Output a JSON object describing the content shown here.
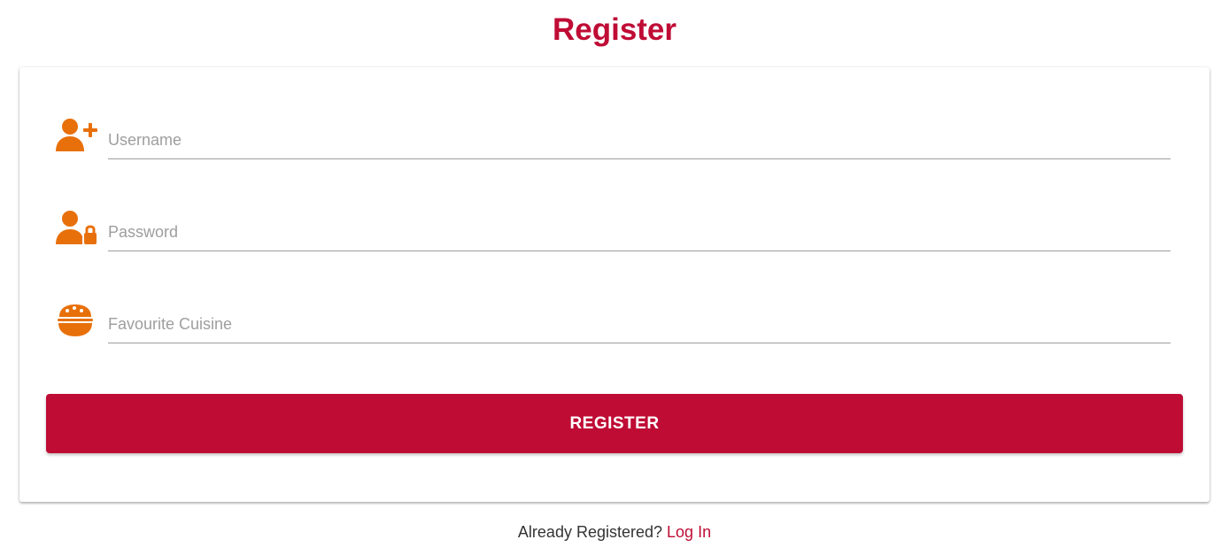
{
  "page": {
    "title": "Register"
  },
  "form": {
    "username": {
      "placeholder": "Username",
      "value": "",
      "icon": "user-plus-icon"
    },
    "password": {
      "placeholder": "Password",
      "value": "",
      "icon": "user-lock-icon"
    },
    "cuisine": {
      "placeholder": "Favourite Cuisine",
      "value": "",
      "icon": "food-bowl-icon"
    },
    "submit_label": "REGISTER"
  },
  "footer": {
    "prompt": "Already Registered?",
    "login_link": "Log In"
  },
  "colors": {
    "accent": "#bf0c35",
    "icon": "#e8700a",
    "placeholder": "#9e9e9e"
  }
}
